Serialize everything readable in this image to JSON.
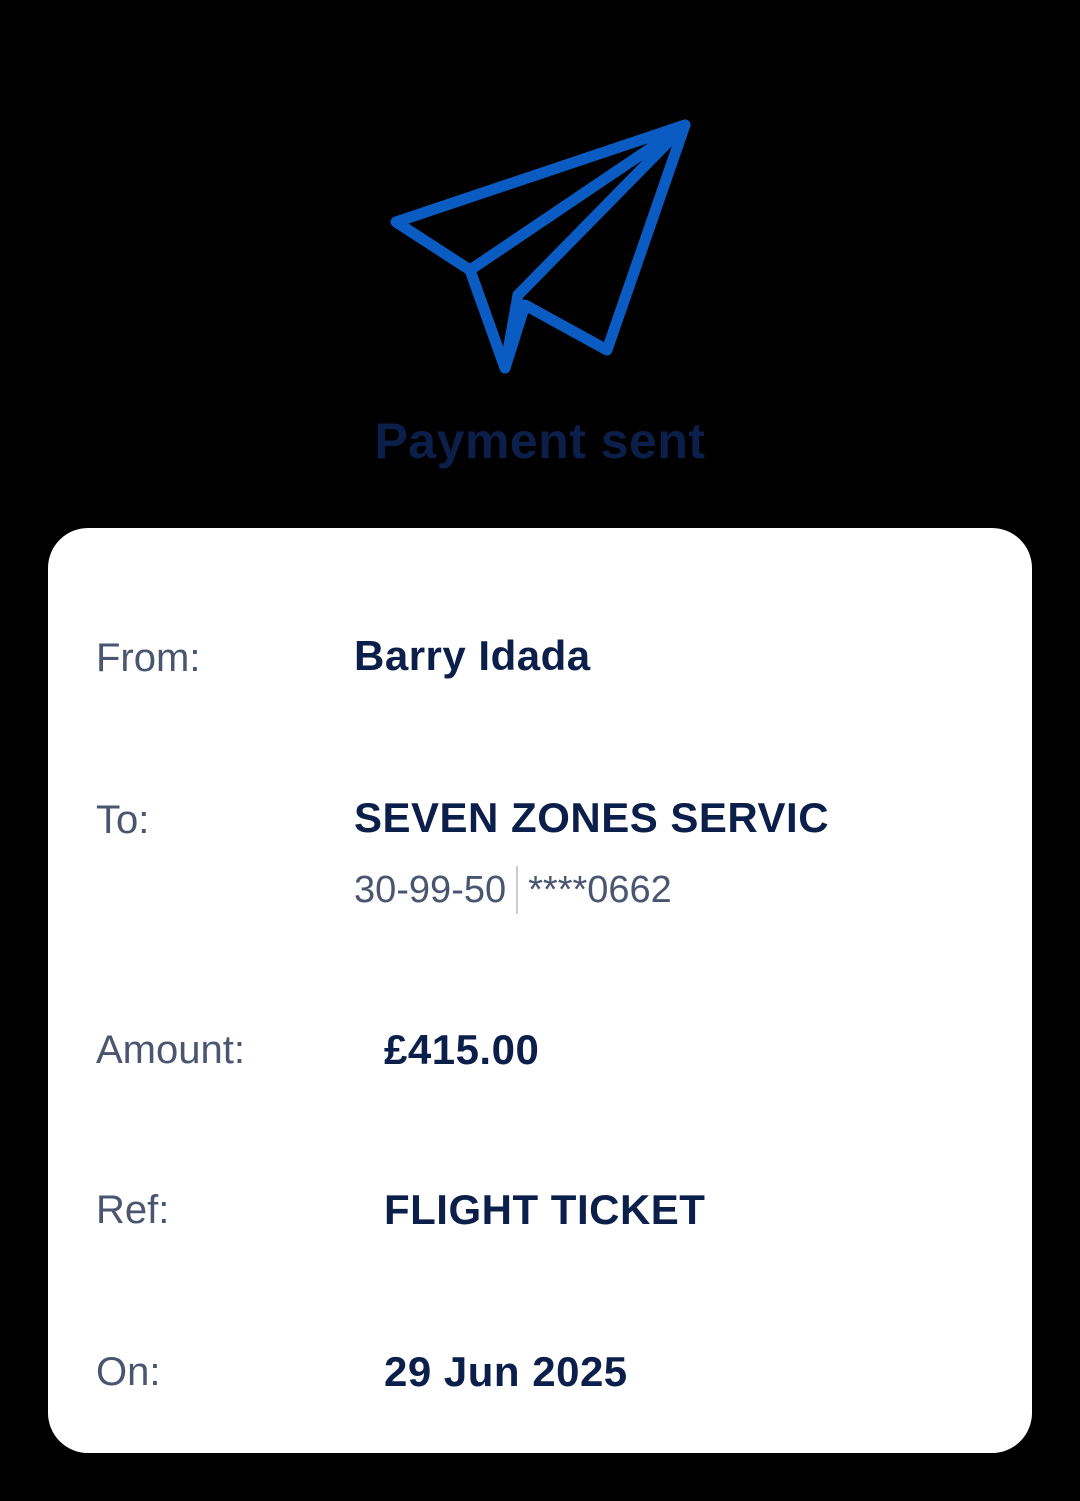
{
  "icon": "paper-plane-icon",
  "accent_color": "#0a5cc2",
  "title_color": "#0c1f4a",
  "heading": "Payment sent",
  "details": {
    "from_label": "From:",
    "from_value": "Barry Idada",
    "to_label": "To:",
    "to_value": "SEVEN ZONES SERVIC",
    "sort_code": "30-99-50",
    "account_number": "****0662",
    "amount_label": "Amount:",
    "amount_value": "£415.00",
    "ref_label": "Ref:",
    "ref_value": "FLIGHT TICKET",
    "on_label": "On:",
    "on_value": "29 Jun 2025"
  }
}
